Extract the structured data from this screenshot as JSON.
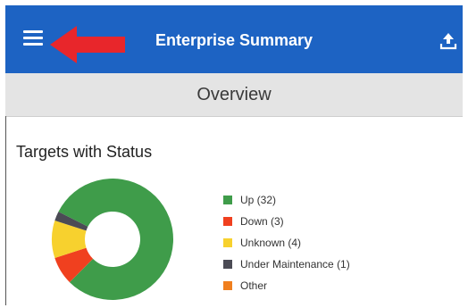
{
  "header": {
    "title": "Enterprise Summary",
    "menu_icon": "hamburger-menu-icon",
    "upload_icon": "upload-icon",
    "bar_color": "#1d63c3",
    "annotation_arrow_color": "#e8262b"
  },
  "tabbar": {
    "title": "Overview"
  },
  "targets": {
    "title": "Targets with Status",
    "legend": [
      {
        "label": "Up (32)",
        "color": "#3f9c4a"
      },
      {
        "label": "Down (3)",
        "color": "#f0401f"
      },
      {
        "label": "Unknown (4)",
        "color": "#f7d12e"
      },
      {
        "label": "Under Maintenance (1)",
        "color": "#4b4b55"
      },
      {
        "label": "Other",
        "color": "#f07f1e"
      }
    ]
  },
  "chart_data": {
    "type": "pie",
    "donut": true,
    "title": "Targets with Status",
    "categories": [
      "Up",
      "Down",
      "Unknown",
      "Under Maintenance",
      "Other"
    ],
    "values": [
      32,
      3,
      4,
      1,
      0
    ],
    "colors": [
      "#3f9c4a",
      "#f0401f",
      "#f7d12e",
      "#4b4b55",
      "#f07f1e"
    ]
  }
}
